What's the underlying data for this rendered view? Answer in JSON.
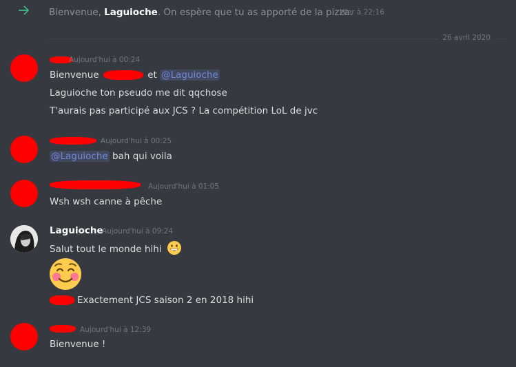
{
  "system_message": {
    "prefix": "Bienvenue, ",
    "name": "Laguioche",
    "suffix": ". On espère que tu as apporté de la pizza.",
    "timestamp": "Hier à 22:16"
  },
  "date_divider": "26 avril 2020",
  "messages": [
    {
      "timestamp": "Aujourd'hui à 00:24",
      "lines": {
        "l1_prefix": "Bienvenue",
        "l1_and": "et",
        "l1_mention": "@Laguioche",
        "l2": "Laguioche ton pseudo me dit qqchose",
        "l3": "T'aurais pas participé aux JCS ? La compétition LoL de jvc"
      }
    },
    {
      "timestamp": "Aujourd'hui à 00:25",
      "mention": "@Laguioche",
      "text": " bah qui voila"
    },
    {
      "timestamp": "Aujourd'hui à 01:05",
      "text": "Wsh wsh canne à pêche"
    },
    {
      "author": "Laguioche",
      "timestamp": "Aujourd'hui à 09:24",
      "text": "Salut tout le monde hihi",
      "emoji_inline": "grinning-emoji",
      "emoji_big": "smiling-blush-emoji",
      "reply_text": "Exactement JCS saison 2 en 2018 hihi"
    },
    {
      "timestamp": "Aujourd'hui à 12:39",
      "text": "Bienvenue !"
    }
  ],
  "colors": {
    "background": "#36393f",
    "redaction": "#ff0000",
    "mention": "#7289da",
    "join_arrow": "#43b581"
  }
}
